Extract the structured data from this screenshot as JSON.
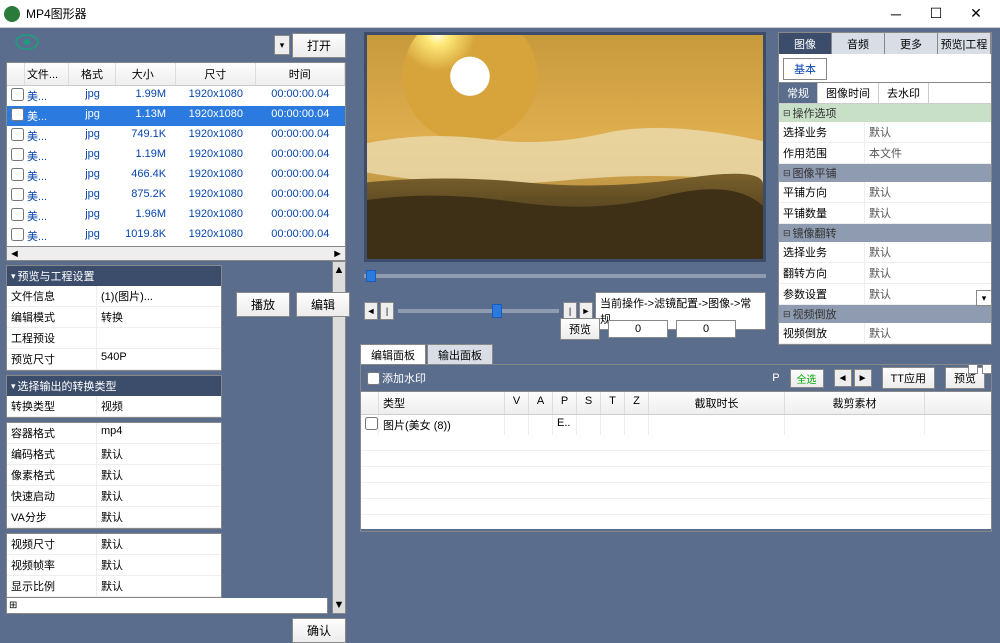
{
  "app": {
    "title": "MP4图形器"
  },
  "toolbar": {
    "open": "打开"
  },
  "file_table": {
    "headers": {
      "name": "文件...",
      "format": "格式",
      "size": "大小",
      "dim": "尺寸",
      "time": "时间"
    },
    "rows": [
      {
        "name": "美...",
        "fmt": "jpg",
        "size": "1.99M",
        "dim": "1920x1080",
        "time": "00:00:00.04",
        "sel": false
      },
      {
        "name": "美...",
        "fmt": "jpg",
        "size": "1.13M",
        "dim": "1920x1080",
        "time": "00:00:00.04",
        "sel": true
      },
      {
        "name": "美...",
        "fmt": "jpg",
        "size": "749.1K",
        "dim": "1920x1080",
        "time": "00:00:00.04",
        "sel": false
      },
      {
        "name": "美...",
        "fmt": "jpg",
        "size": "1.19M",
        "dim": "1920x1080",
        "time": "00:00:00.04",
        "sel": false
      },
      {
        "name": "美...",
        "fmt": "jpg",
        "size": "466.4K",
        "dim": "1920x1080",
        "time": "00:00:00.04",
        "sel": false
      },
      {
        "name": "美...",
        "fmt": "jpg",
        "size": "875.2K",
        "dim": "1920x1080",
        "time": "00:00:00.04",
        "sel": false
      },
      {
        "name": "美...",
        "fmt": "jpg",
        "size": "1.96M",
        "dim": "1920x1080",
        "time": "00:00:00.04",
        "sel": false
      },
      {
        "name": "美...",
        "fmt": "jpg",
        "size": "1019.8K",
        "dim": "1920x1080",
        "time": "00:00:00.04",
        "sel": false
      }
    ]
  },
  "left_props": {
    "sec1": {
      "title": "预览与工程设置",
      "rows": [
        {
          "k": "文件信息",
          "v": "(1)(图片)..."
        },
        {
          "k": "编辑模式",
          "v": "转换"
        },
        {
          "k": "工程预设",
          "v": ""
        },
        {
          "k": "预览尺寸",
          "v": "540P"
        }
      ]
    },
    "sec2": {
      "title": "选择输出的转换类型",
      "rows": [
        {
          "k": "转换类型",
          "v": "视频"
        }
      ]
    },
    "sec3_rows": [
      {
        "k": "容器格式",
        "v": "mp4"
      },
      {
        "k": "编码格式",
        "v": "默认"
      },
      {
        "k": "像素格式",
        "v": "默认"
      },
      {
        "k": "快速启动",
        "v": "默认"
      },
      {
        "k": "VA分步",
        "v": "默认"
      }
    ],
    "sec4_rows": [
      {
        "k": "视频尺寸",
        "v": "默认"
      },
      {
        "k": "视频帧率",
        "v": "默认"
      },
      {
        "k": "显示比例",
        "v": "默认"
      }
    ],
    "confirm": "确认"
  },
  "center": {
    "play": "播放",
    "edit": "编辑",
    "status": "当前操作->滤镜配置->图像->常规",
    "preview": "预览",
    "val1": "0",
    "val2": "0"
  },
  "panel_tabs": {
    "edit": "编辑面板",
    "output": "输出面板"
  },
  "edit_panel": {
    "add_wm": "添加水印",
    "p_label": "P",
    "select_all": "全选",
    "tt_apply": "TT应用",
    "preview": "预览",
    "headers": {
      "type": "类型",
      "v": "V",
      "a": "A",
      "p": "P",
      "s": "S",
      "t": "T",
      "z": "Z",
      "dur": "截取时长",
      "mat": "裁剪素材"
    },
    "rows": [
      {
        "checked": false,
        "type": "图片(美女 (8))",
        "v": "",
        "a": "",
        "p": "E..",
        "s": "",
        "t": "",
        "z": "",
        "dur": "",
        "mat": ""
      }
    ]
  },
  "right": {
    "tabs": {
      "image": "图像",
      "audio": "音频",
      "more": "更多",
      "preview_proj": "预览|工程"
    },
    "subtab": "基本",
    "prop_tabs": {
      "normal": "常规",
      "img_time": "图像时间",
      "dewm": "去水印"
    },
    "groups": [
      {
        "title": "操作选项",
        "rows": [
          {
            "k": "选择业务",
            "v": "默认"
          },
          {
            "k": "作用范围",
            "v": "本文件"
          }
        ]
      },
      {
        "title": "图像平铺",
        "rows": [
          {
            "k": "平铺方向",
            "v": "默认"
          },
          {
            "k": "平铺数量",
            "v": "默认"
          }
        ]
      },
      {
        "title": "镜像翻转",
        "rows": [
          {
            "k": "选择业务",
            "v": "默认"
          },
          {
            "k": "翻转方向",
            "v": "默认"
          },
          {
            "k": "参数设置",
            "v": "默认"
          }
        ]
      },
      {
        "title": "视频倒放",
        "rows": [
          {
            "k": "视频倒放",
            "v": "默认"
          }
        ]
      }
    ]
  }
}
